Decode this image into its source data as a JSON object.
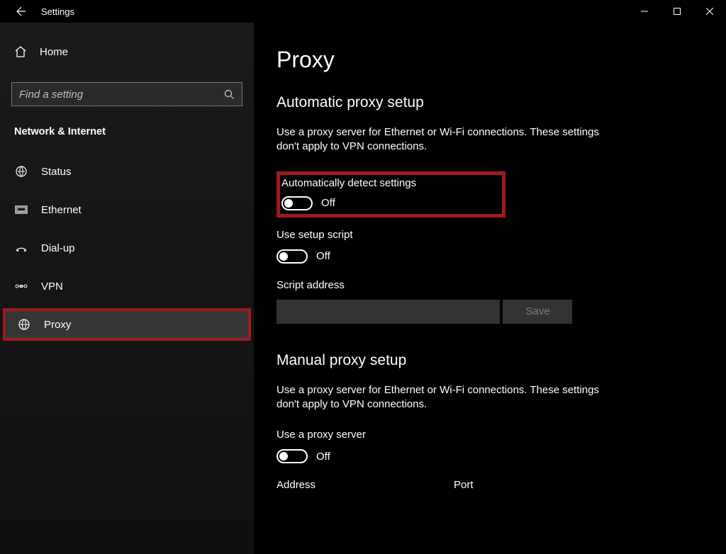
{
  "titlebar": {
    "title": "Settings"
  },
  "sidebar": {
    "home": "Home",
    "search_placeholder": "Find a setting",
    "section": "Network & Internet",
    "items": [
      {
        "label": "Status",
        "icon": "status"
      },
      {
        "label": "Ethernet",
        "icon": "ethernet"
      },
      {
        "label": "Dial-up",
        "icon": "dialup"
      },
      {
        "label": "VPN",
        "icon": "vpn"
      },
      {
        "label": "Proxy",
        "icon": "globe"
      }
    ]
  },
  "main": {
    "title": "Proxy",
    "auto": {
      "heading": "Automatic proxy setup",
      "desc": "Use a proxy server for Ethernet or Wi-Fi connections. These settings don't apply to VPN connections.",
      "detect_label": "Automatically detect settings",
      "detect_state": "Off",
      "script_label": "Use setup script",
      "script_state": "Off",
      "script_addr_label": "Script address",
      "save": "Save"
    },
    "manual": {
      "heading": "Manual proxy setup",
      "desc": "Use a proxy server for Ethernet or Wi-Fi connections. These settings don't apply to VPN connections.",
      "use_label": "Use a proxy server",
      "use_state": "Off",
      "address_label": "Address",
      "port_label": "Port"
    }
  }
}
